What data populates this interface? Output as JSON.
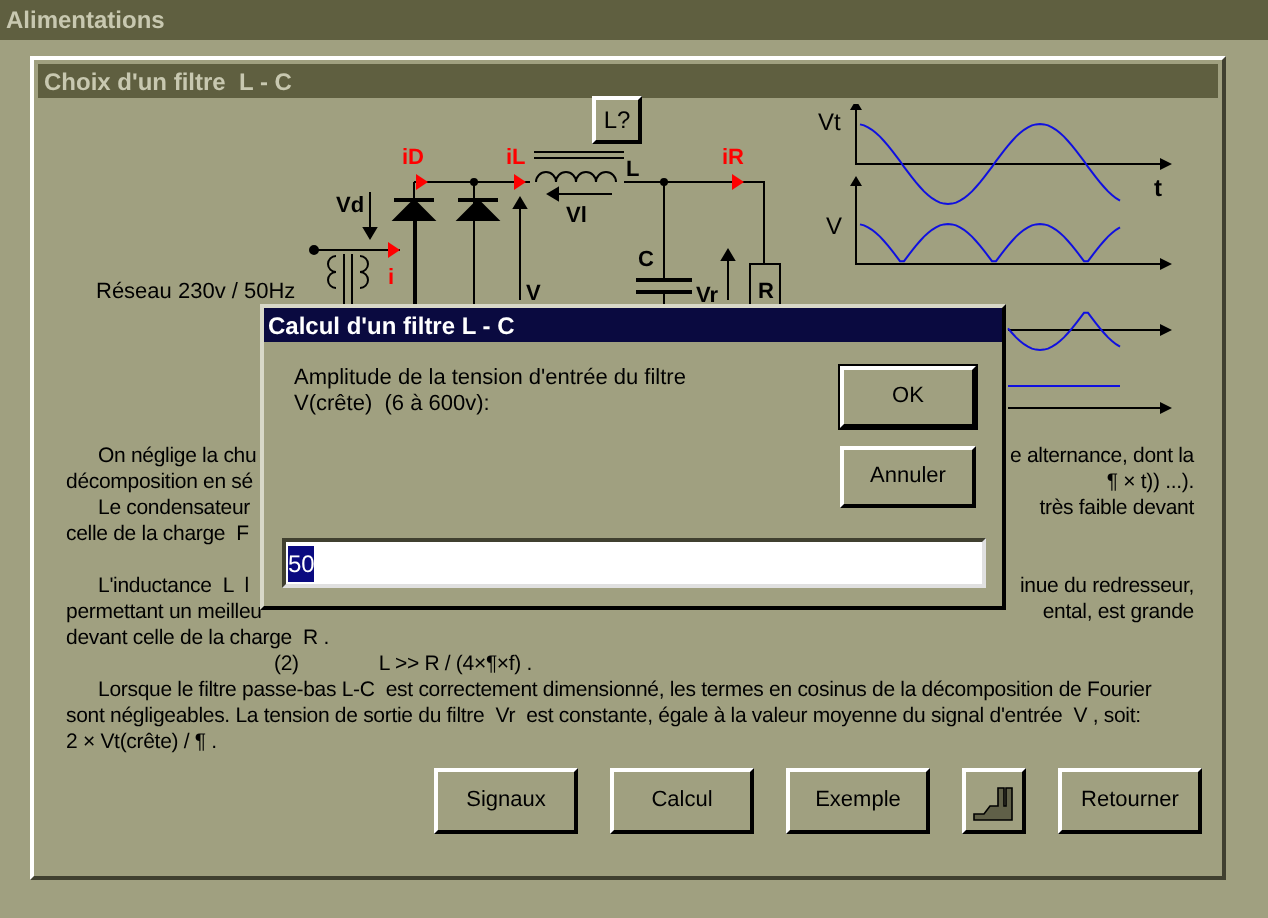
{
  "window": {
    "title": "Alimentations"
  },
  "panel": {
    "title": "Choix d'un filtre  L - C"
  },
  "circuit": {
    "mains_label": "Réseau 230v / 50Hz",
    "help_button": "L?",
    "labels": [
      {
        "text": "iD",
        "kind": "current"
      },
      {
        "text": "iL",
        "kind": "current"
      },
      {
        "text": "iR",
        "kind": "current"
      },
      {
        "text": "i",
        "kind": "current"
      },
      {
        "text": "Vd",
        "kind": "voltage"
      },
      {
        "text": "Vl",
        "kind": "voltage"
      },
      {
        "text": "L",
        "kind": "voltage"
      },
      {
        "text": "C",
        "kind": "voltage"
      },
      {
        "text": "V",
        "kind": "voltage"
      },
      {
        "text": "Vr",
        "kind": "voltage"
      },
      {
        "text": "R",
        "kind": "voltage"
      }
    ]
  },
  "waveforms": {
    "labels": [
      "Vt",
      "t",
      "V"
    ]
  },
  "text_lines": [
    {
      "kind": "split",
      "indent": true,
      "left": "On néglige la chu",
      "right": "e alternance, dont la"
    },
    {
      "kind": "split",
      "indent": false,
      "left": "décomposition en sé",
      "right": "¶ × t)) ...)."
    },
    {
      "kind": "split",
      "indent": true,
      "left": "Le condensateur",
      "right": "très faible devant"
    },
    {
      "kind": "split",
      "indent": false,
      "left": "celle de la charge  F"
    },
    {
      "kind": "blank"
    },
    {
      "kind": "split",
      "indent": true,
      "left": "L'inductance  L  l",
      "right": "inue du redresseur,"
    },
    {
      "kind": "split",
      "indent": false,
      "left": "permettant un meilleu",
      "right": "ental, est grande"
    },
    {
      "kind": "full",
      "indent": false,
      "text": "devant celle de la charge  R ."
    },
    {
      "kind": "formula",
      "number": "(2)",
      "text": "L >> R / (4×¶×f) ."
    },
    {
      "kind": "full",
      "indent": true,
      "text": "Lorsque le filtre passe-bas L-C  est correctement dimensionné, les termes en cosinus de la décomposition de Fourier"
    },
    {
      "kind": "full",
      "indent": false,
      "text": "sont négligeables. La tension de sortie du filtre  Vr  est constante, égale à la valeur moyenne du signal d'entrée  V , soit:"
    },
    {
      "kind": "full",
      "indent": false,
      "text": "2 × Vt(crête) / ¶ ."
    }
  ],
  "buttons": [
    {
      "kind": "text",
      "label": "Signaux"
    },
    {
      "kind": "text",
      "label": "Calcul"
    },
    {
      "kind": "text",
      "label": "Exemple"
    },
    {
      "kind": "icon"
    },
    {
      "kind": "text",
      "label": "Retourner"
    }
  ],
  "dialog": {
    "title": "Calcul d'un filtre L - C",
    "prompt": [
      "Amplitude de la tension d'entrée du filtre",
      "V(crête)  (6 à 600v):"
    ],
    "buttons": [
      "OK",
      "Annuler"
    ],
    "input": {
      "value": "50",
      "selected": true
    }
  }
}
